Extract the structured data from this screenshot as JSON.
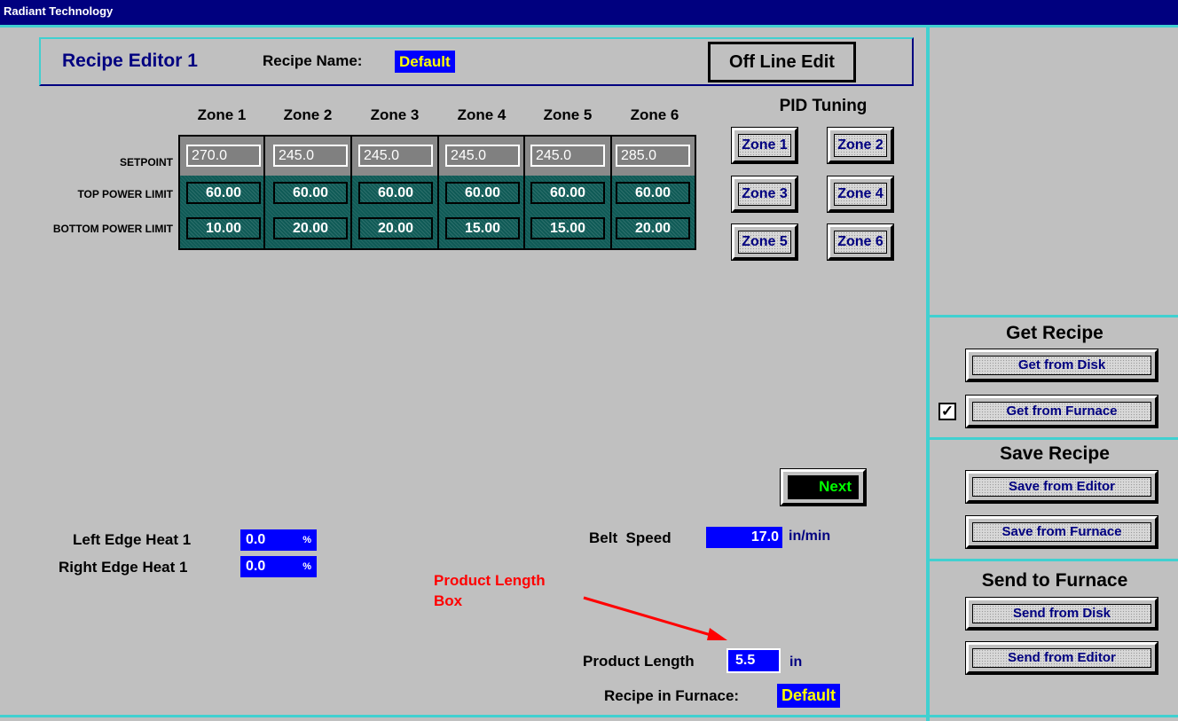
{
  "window_title": "Radiant Technology",
  "header": {
    "title": "Recipe Editor 1",
    "recipe_name_label": "Recipe Name:",
    "recipe_name": "Default",
    "mode_button": "Off Line Edit"
  },
  "zones": [
    "Zone 1",
    "Zone 2",
    "Zone 3",
    "Zone 4",
    "Zone 5",
    "Zone 6"
  ],
  "rows": {
    "setpoint": {
      "label": "SETPOINT",
      "values": [
        "270.0",
        "245.0",
        "245.0",
        "245.0",
        "245.0",
        "285.0"
      ]
    },
    "top_power": {
      "label": "TOP POWER LIMIT",
      "values": [
        "60.00",
        "60.00",
        "60.00",
        "60.00",
        "60.00",
        "60.00"
      ]
    },
    "bottom_power": {
      "label": "BOTTOM POWER LIMIT",
      "values": [
        "10.00",
        "20.00",
        "20.00",
        "15.00",
        "15.00",
        "20.00"
      ]
    }
  },
  "pid": {
    "title": "PID Tuning",
    "buttons": [
      "Zone 1",
      "Zone 2",
      "Zone 3",
      "Zone 4",
      "Zone 5",
      "Zone 6"
    ]
  },
  "next_button": "Next",
  "edge_heat": {
    "left_label": "Left Edge Heat 1",
    "left_value": "0.0",
    "left_unit": "%",
    "right_label": "Right Edge Heat 1",
    "right_value": "0.0",
    "right_unit": "%"
  },
  "belt_speed": {
    "label": "Belt  Speed",
    "value": "17.0",
    "unit": "in/min"
  },
  "annotation": {
    "line1": "Product Length",
    "line2": "Box",
    "color": "#ff0000"
  },
  "product_length": {
    "label": "Product Length",
    "value": "5.5",
    "unit": "in"
  },
  "recipe_in_furnace": {
    "label": "Recipe in Furnace:",
    "value": "Default"
  },
  "side": {
    "get_title": "Get Recipe",
    "get_disk": "Get from Disk",
    "get_furnace": "Get from Furnace",
    "get_furnace_checked": true,
    "save_title": "Save Recipe",
    "save_editor": "Save from Editor",
    "save_furnace": "Save from Furnace",
    "send_title": "Send to Furnace",
    "send_disk": "Send from Disk",
    "send_editor": "Send from Editor"
  },
  "colors": {
    "title_bar": "#00007f",
    "background": "#c0c0c0",
    "accent_frame": "#40d0d0",
    "limit_cells": "#0f5a56",
    "field_blue": "#0000ff"
  }
}
